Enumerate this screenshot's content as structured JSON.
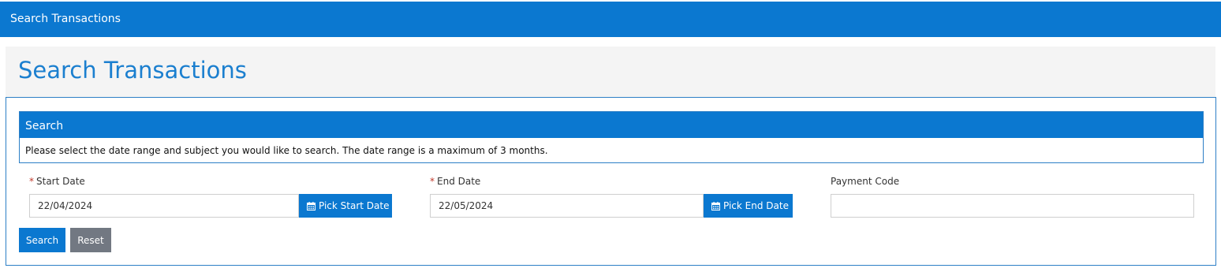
{
  "app": {
    "title": "Search Transactions"
  },
  "page": {
    "title": "Search Transactions"
  },
  "search_card": {
    "header": "Search",
    "description": "Please select the date range and subject you would like to search. The date range is a maximum of 3 months."
  },
  "fields": {
    "start_date": {
      "required_mark": "*",
      "label": "Start Date",
      "value": "22/04/2024",
      "button_label": "Pick Start Date"
    },
    "end_date": {
      "required_mark": "*",
      "label": "End Date",
      "value": "22/05/2024",
      "button_label": "Pick End Date"
    },
    "payment_code": {
      "label": "Payment Code",
      "value": ""
    }
  },
  "actions": {
    "search_label": "Search",
    "reset_label": "Reset"
  },
  "icons": {
    "date_picker": "calendar-icon"
  },
  "colors": {
    "primary": "#0b78d0",
    "title_blue": "#1b7fcf",
    "reset_gray": "#727882",
    "required_red": "#c0392b",
    "header_bg": "#f4f4f4"
  }
}
